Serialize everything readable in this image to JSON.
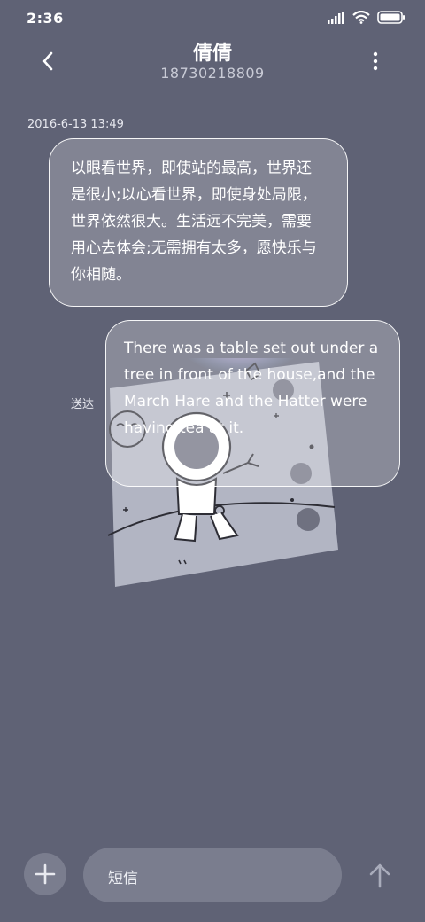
{
  "status_bar": {
    "time": "2:36",
    "icons": [
      "signal-icon",
      "wifi-icon",
      "battery-icon"
    ]
  },
  "header": {
    "contact_name": "倩倩",
    "phone_number": "18730218809",
    "icons": [
      "back-icon",
      "more-icon"
    ]
  },
  "conversation": {
    "timestamp": "2016-6-13 13:49",
    "received_message": "以眼看世界，即使站的最高，世界还是很小;以心看世界，即使身处局限，世界依然很大。生活远不完美，需要用心去体会;无需拥有太多，愿快乐与你相随。",
    "sent_message": "There was a table set out under a tree in front of the house,and the March Hare and the Hatter were having tea at it.",
    "sent_status": "送达",
    "sticker": "astronaut-sticker"
  },
  "composer": {
    "placeholder": "短信",
    "icons": [
      "plus-icon",
      "send-arrow-icon"
    ]
  },
  "colors": {
    "background": "#5f6275",
    "bubble_border": "#ffffff",
    "composer_fill": "#7a7d8e"
  }
}
